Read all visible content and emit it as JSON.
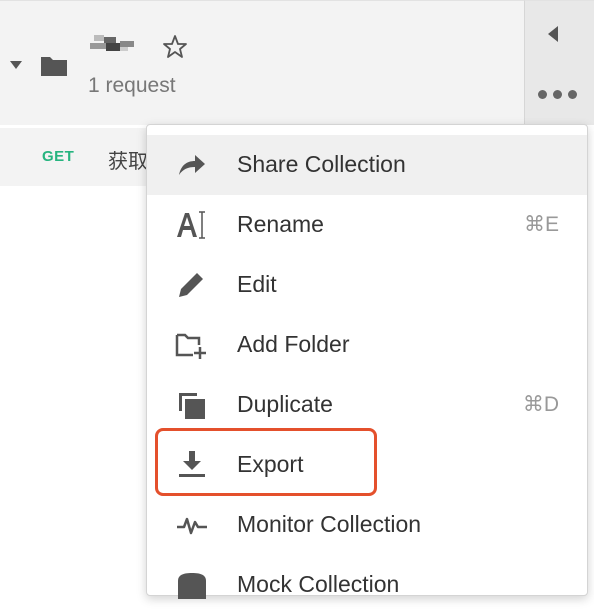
{
  "collection": {
    "request_count": "1 request"
  },
  "request": {
    "method": "GET",
    "name": "获取"
  },
  "menu": {
    "items": [
      {
        "label": "Share Collection",
        "shortcut": ""
      },
      {
        "label": "Rename",
        "shortcut": "⌘E"
      },
      {
        "label": "Edit",
        "shortcut": ""
      },
      {
        "label": "Add Folder",
        "shortcut": ""
      },
      {
        "label": "Duplicate",
        "shortcut": "⌘D"
      },
      {
        "label": "Export",
        "shortcut": ""
      },
      {
        "label": "Monitor Collection",
        "shortcut": ""
      },
      {
        "label": "Mock Collection",
        "shortcut": ""
      }
    ]
  },
  "colors": {
    "get_method": "#26b47f",
    "highlight": "#e4502c"
  }
}
